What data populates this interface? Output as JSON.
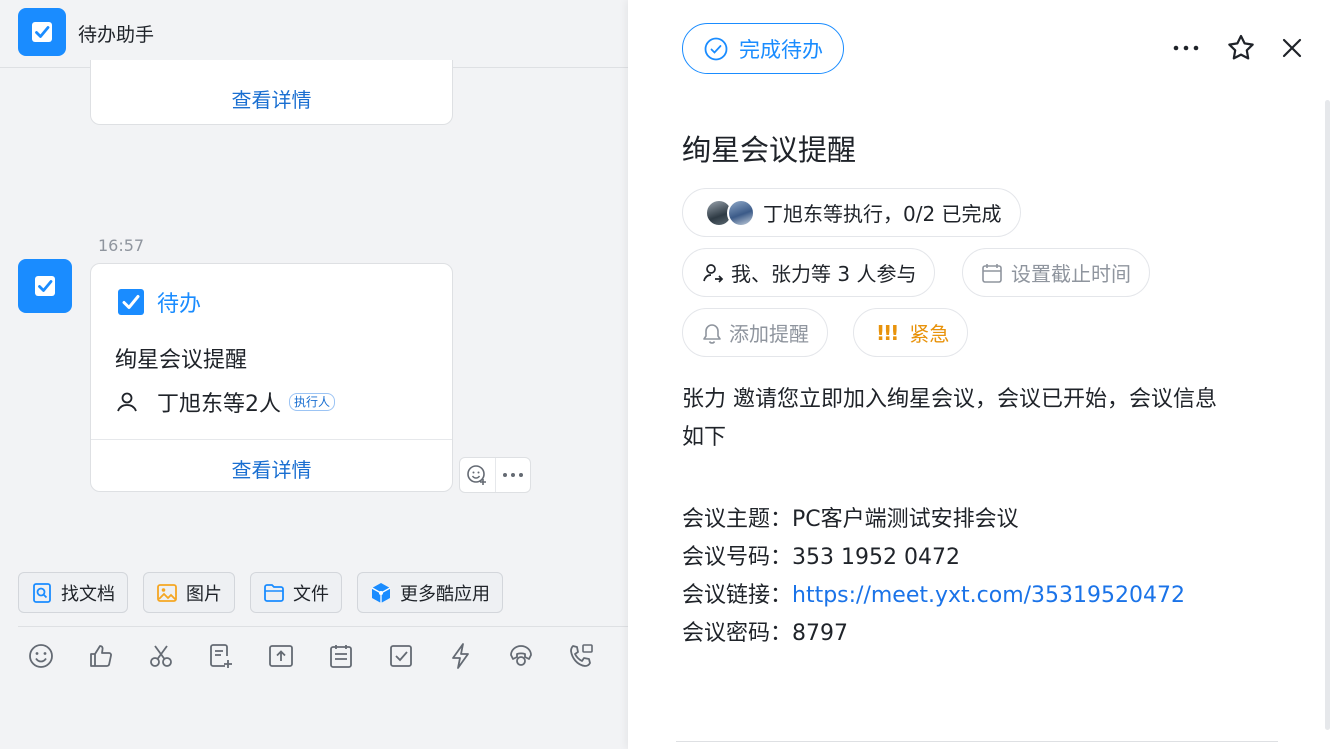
{
  "chat": {
    "title": "待办助手",
    "top_card": {
      "view_details": "查看详情"
    },
    "timestamp": "16:57",
    "card": {
      "kind": "待办",
      "task_title": "绚星会议提醒",
      "assignees": "丁旭东等2人",
      "assignee_tag": "执行人",
      "view_details": "查看详情"
    },
    "quick_actions": [
      "找文档",
      "图片",
      "文件",
      "更多酷应用"
    ],
    "toolbar_icons": [
      "emoji-icon",
      "thumbs-up-icon",
      "scissors-icon",
      "doc-add-icon",
      "upload-icon",
      "calendar-icon",
      "todo-check-icon",
      "lightning-icon",
      "phone-icon",
      "phone-forward-icon"
    ]
  },
  "detail": {
    "complete_button": "完成待办",
    "task_title": "绚星会议提醒",
    "executors": "丁旭东等执行，0/2 已完成",
    "participants": "我、张力等 3 人参与",
    "deadline_placeholder": "设置截止时间",
    "reminder_placeholder": "添加提醒",
    "urgent_mark": "!!!",
    "urgent_label": "紧急",
    "description_line1": "张力 邀请您立即加入绚星会议，会议已开始，会议信息",
    "description_line2": "如下",
    "meeting": {
      "topic_label": "会议主题：",
      "topic_value": "PC客户端测试安排会议",
      "number_label": "会议号码：",
      "number_value": "353 1952 0472",
      "link_label": "会议链接：",
      "link_value": "https://meet.yxt.com/35319520472",
      "password_label": "会议密码：",
      "password_value": "8797"
    }
  },
  "colors": {
    "accent": "#1a8cff",
    "link": "#1a73e8",
    "urgent": "#e8930c"
  }
}
